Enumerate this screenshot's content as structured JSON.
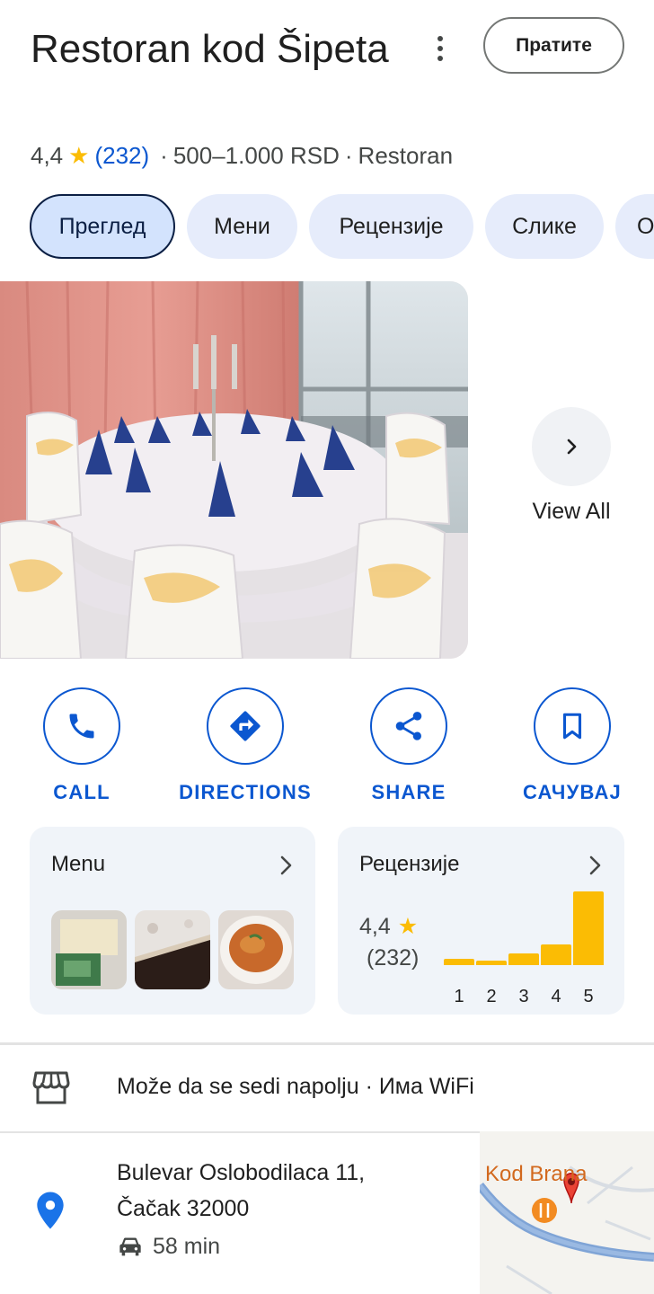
{
  "header": {
    "title": "Restoran kod Šipeta",
    "follow_label": "Пратите",
    "more_icon": "more-vert-icon"
  },
  "meta": {
    "rating": "4,4",
    "review_count": "(232)",
    "separator": "·",
    "price_range": "500–1.000 RSD",
    "category": "Restoran"
  },
  "tabs": [
    {
      "label": "Преглед",
      "active": true
    },
    {
      "label": "Мени"
    },
    {
      "label": "Рецензије"
    },
    {
      "label": "Слике"
    },
    {
      "label": "О"
    }
  ],
  "gallery": {
    "view_all_label": "View All"
  },
  "actions": [
    {
      "label": "CALL",
      "icon": "phone-icon"
    },
    {
      "label": "DIRECTIONS",
      "icon": "directions-icon"
    },
    {
      "label": "SHARE",
      "icon": "share-icon"
    },
    {
      "label": "САЧУВАЈ",
      "icon": "bookmark-icon"
    }
  ],
  "menu_card": {
    "title": "Menu"
  },
  "reviews_card": {
    "title": "Рецензије",
    "rating": "4,4",
    "count": "(232)",
    "distribution": [
      {
        "star": "1",
        "share": 0.08
      },
      {
        "star": "2",
        "share": 0.05
      },
      {
        "star": "3",
        "share": 0.16
      },
      {
        "star": "4",
        "share": 0.28
      },
      {
        "star": "5",
        "share": 1.0
      }
    ]
  },
  "amenities": {
    "text": "Može da se sedi napolju · Има WiFi",
    "icon": "storefront-icon"
  },
  "address": {
    "line1": "Bulevar Oslobodilaca 11,",
    "line2": "Čačak 32000",
    "travel_time": "58 min",
    "icon": "location-pin-icon",
    "travel_icon": "car-icon"
  },
  "map": {
    "label": "Kod Brana"
  },
  "colors": {
    "accent_blue": "#0b57d0",
    "star_yellow": "#fbbc04",
    "chip_bg": "#e6ecfb",
    "card_bg": "#f0f4f9"
  }
}
